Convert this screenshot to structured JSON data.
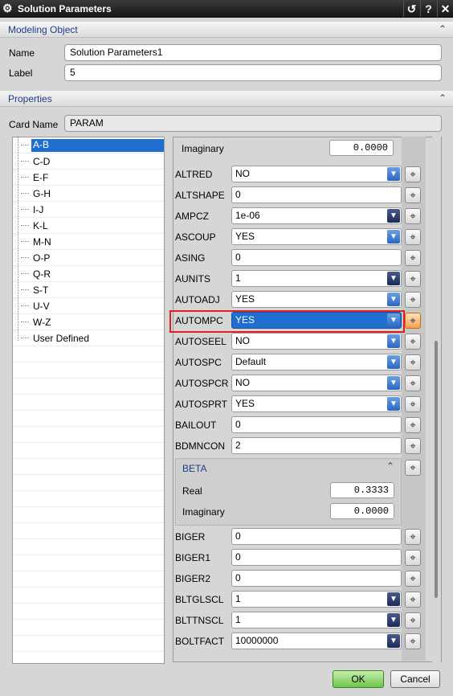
{
  "window": {
    "title": "Solution Parameters",
    "reset_glyph": "↺",
    "help_glyph": "?",
    "close_glyph": "✕"
  },
  "modeling": {
    "header": "Modeling Object",
    "name_label": "Name",
    "name_value": "Solution Parameters1",
    "label_label": "Label",
    "label_value": "5"
  },
  "properties": {
    "header": "Properties",
    "card_label": "Card Name",
    "card_value": "PARAM"
  },
  "tree": [
    "A-B",
    "C-D",
    "E-F",
    "G-H",
    "I-J",
    "K-L",
    "M-N",
    "O-P",
    "Q-R",
    "S-T",
    "U-V",
    "W-Z",
    "User Defined"
  ],
  "top_imag": {
    "label": "Imaginary",
    "value": "0.0000"
  },
  "params1": [
    {
      "label": "ALTRED",
      "value": "NO",
      "kind": "dd"
    },
    {
      "label": "ALTSHAPE",
      "value": "0",
      "kind": "tb"
    },
    {
      "label": "AMPCZ",
      "value": "1e-06",
      "kind": "dd2"
    },
    {
      "label": "ASCOUP",
      "value": "YES",
      "kind": "dd"
    },
    {
      "label": "ASING",
      "value": "0",
      "kind": "tb"
    },
    {
      "label": "AUNITS",
      "value": "1",
      "kind": "dd2"
    },
    {
      "label": "AUTOADJ",
      "value": "YES",
      "kind": "dd"
    },
    {
      "label": "AUTOMPC",
      "value": "YES",
      "kind": "dd",
      "selected": true
    },
    {
      "label": "AUTOSEEL",
      "value": "NO",
      "kind": "dd"
    },
    {
      "label": "AUTOSPC",
      "value": "Default",
      "kind": "dd"
    },
    {
      "label": "AUTOSPCR",
      "value": "NO",
      "kind": "dd"
    },
    {
      "label": "AUTOSPRT",
      "value": "YES",
      "kind": "dd"
    },
    {
      "label": "BAILOUT",
      "value": "0",
      "kind": "tb"
    },
    {
      "label": "BDMNCON",
      "value": "2",
      "kind": "tb"
    }
  ],
  "beta": {
    "header": "BETA",
    "real_label": "Real",
    "real_value": "0.3333",
    "imag_label": "Imaginary",
    "imag_value": "0.0000"
  },
  "params2": [
    {
      "label": "BIGER",
      "value": "0",
      "kind": "tb"
    },
    {
      "label": "BIGER1",
      "value": "0",
      "kind": "tb"
    },
    {
      "label": "BIGER2",
      "value": "0",
      "kind": "tb"
    },
    {
      "label": "BLTGLSCL",
      "value": "1",
      "kind": "dd2"
    },
    {
      "label": "BLTTNSCL",
      "value": "1",
      "kind": "dd2"
    },
    {
      "label": "BOLTFACT",
      "value": "10000000",
      "kind": "dd2"
    }
  ],
  "buttons": {
    "ok": "OK",
    "cancel": "Cancel"
  },
  "icons": {
    "gear": "gear-icon",
    "chevron": "chevron-up-icon",
    "pick": "crosshair-picker-icon",
    "dropdown": "dropdown-arrow-icon"
  }
}
